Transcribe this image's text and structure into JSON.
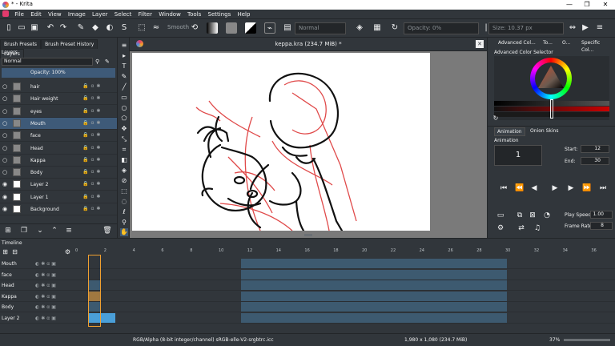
{
  "window": {
    "title": "* - Krita",
    "minimize": "—",
    "maximize": "❐",
    "close": "✕"
  },
  "menu": [
    "File",
    "Edit",
    "View",
    "Image",
    "Layer",
    "Select",
    "Filter",
    "Window",
    "Tools",
    "Settings",
    "Help"
  ],
  "toolbar": {
    "smooth_label": "Smooth",
    "blend_mode": "Normal",
    "opacity": "Opacity: 0%",
    "size": "Size: 10.37 px"
  },
  "left_tabs": [
    "Brush Presets",
    "Brush Preset History",
    "Layers"
  ],
  "layers_panel": {
    "title": "Layers",
    "blend_mode": "Normal",
    "opacity": "Opacity: 100%",
    "layers": [
      {
        "name": "hair",
        "visible": false,
        "thumb": "grey",
        "selected": false
      },
      {
        "name": "Hair weight",
        "visible": false,
        "thumb": "grey",
        "selected": false
      },
      {
        "name": "eyes",
        "visible": false,
        "thumb": "grey",
        "selected": false
      },
      {
        "name": "Mouth",
        "visible": false,
        "thumb": "grey",
        "selected": true
      },
      {
        "name": "face",
        "visible": false,
        "thumb": "grey",
        "selected": false
      },
      {
        "name": "Head",
        "visible": false,
        "thumb": "grey",
        "selected": false
      },
      {
        "name": "Kappa",
        "visible": false,
        "thumb": "grey",
        "selected": false
      },
      {
        "name": "Body",
        "visible": false,
        "thumb": "grey",
        "selected": false
      },
      {
        "name": "Layer 2",
        "visible": true,
        "thumb": "white",
        "selected": false
      },
      {
        "name": "Layer 1",
        "visible": true,
        "thumb": "white",
        "selected": false
      },
      {
        "name": "Background",
        "visible": true,
        "thumb": "white",
        "selected": false
      }
    ]
  },
  "document": {
    "tab_title": "keppa.kra (234.7 MiB) *"
  },
  "right_tabs": [
    "Advanced Col...",
    "To...",
    "O...",
    "Specific Col..."
  ],
  "color_selector": {
    "title": "Advanced Color Selector"
  },
  "animation": {
    "tabs": [
      "Animation",
      "Onion Skins"
    ],
    "title": "Animation",
    "current_frame": "1",
    "start_label": "Start:",
    "start_value": "12",
    "end_label": "End:",
    "end_value": "30",
    "play_speed_label": "Play Speed:",
    "play_speed_value": "1.00",
    "frame_rate_label": "Frame Rate:",
    "frame_rate_value": "8"
  },
  "timeline": {
    "title": "Timeline",
    "ruler": [
      "0",
      "2",
      "4",
      "6",
      "8",
      "10",
      "12",
      "14",
      "16",
      "18",
      "20",
      "22",
      "24",
      "26",
      "28",
      "30",
      "32",
      "34",
      "36"
    ],
    "rows": [
      "Mouth",
      "face",
      "Head",
      "Kappa",
      "Body",
      "Layer 2"
    ]
  },
  "statusbar": {
    "color_info": "RGB/Alpha (8-bit integer/channel)  sRGB-elle-V2-srgbtrc.icc",
    "image_info": "1,980 x 1,080 (234.7 MiB)",
    "zoom": "37%"
  },
  "colors": {
    "ui_bg": "#31363b",
    "selection": "#3e5a78",
    "frame_fill": "#3d5a70",
    "frame_active": "#4a9fd8",
    "frame_key": "#a07840",
    "playhead": "#f0a030",
    "sketch_red": "#e04a4a"
  }
}
